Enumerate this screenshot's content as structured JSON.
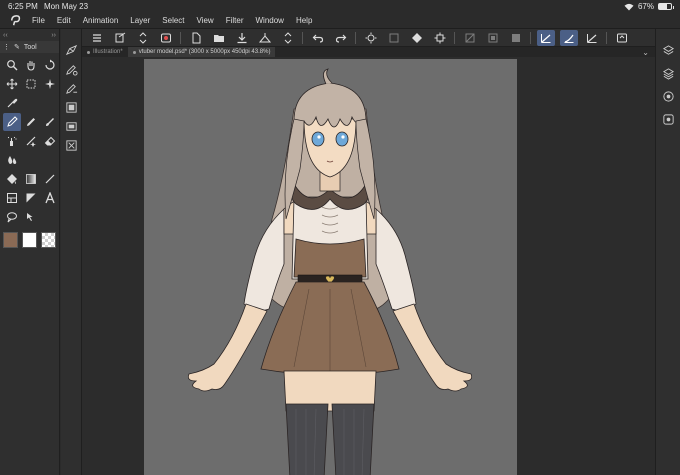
{
  "status": {
    "time": "6:25 PM",
    "date": "Mon May 23",
    "battery": "67%",
    "battery_level": 0.67
  },
  "menu": {
    "items": [
      "File",
      "Edit",
      "Animation",
      "Layer",
      "Select",
      "View",
      "Filter",
      "Window",
      "Help"
    ]
  },
  "tool_panel": {
    "title": "Tool",
    "tools": [
      "zoom-icon",
      "hand-icon",
      "rotate-icon",
      "move-icon",
      "selection-icon",
      "auto-select-icon",
      "eyedropper-icon",
      "",
      "",
      "pen-icon",
      "pencil-icon",
      "brush-icon",
      "airbrush-icon",
      "decoration-icon",
      "eraser-icon",
      "blend-icon",
      "",
      "",
      "fill-icon",
      "gradient-icon",
      "figure-icon",
      "frame-icon",
      "ruler-icon",
      "text-icon",
      "balloon-icon",
      "correct-line-icon",
      ""
    ],
    "active_tool": "pen-icon",
    "colors": {
      "main": "#8a6a55",
      "sub": "#ffffff"
    }
  },
  "tabs": [
    {
      "label": "Illustration*",
      "active": false
    },
    {
      "label": "vtuber model.psd* (3000 x 5000px 450dpi 43.8%)",
      "active": true
    }
  ],
  "theme": {
    "accent": "#4b5f86",
    "canvas_bg": "#6d6d6d"
  }
}
